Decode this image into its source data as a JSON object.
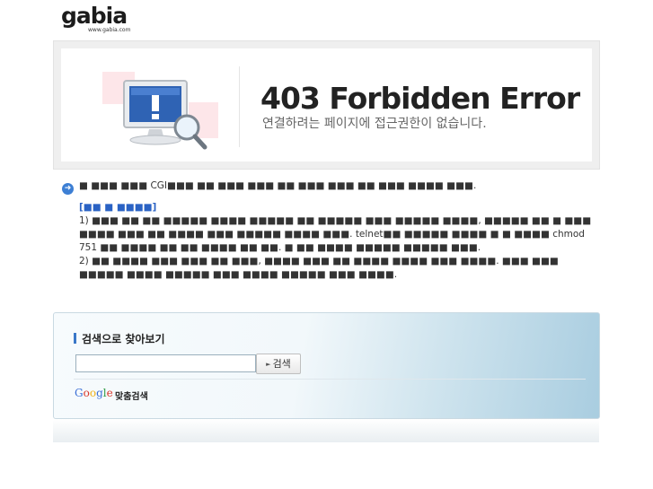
{
  "logo": {
    "word": "gabia",
    "url": "www.gabia.com"
  },
  "error": {
    "title": "403 Forbidden Error",
    "subtitle": "연결하려는 페이지에 접근권한이 없습니다."
  },
  "info": {
    "line1": "■ ■■■ ■■■ CGI■■■ ■■ ■■■ ■■■ ■■ ■■■ ■■■ ■■ ■■■ ■■■■ ■■■.",
    "heading": "[■■ ■ ■■■■]",
    "line2": "1) ■■■ ■■ ■■ ■■■■■ ■■■■ ■■■■■ ■■ ■■■■■ ■■■ ■■■■■ ■■■■, ■■■■■ ■■ ■ ■■■ ■■■■ ■■■ ■■ ■■■■ ■■■ ■■■■■ ■■■■ ■■■. telnet■■ ■■■■■ ■■■■ ■ ■ ■■■■ chmod 751 ■■ ■■■■ ■■ ■■ ■■■■ ■■ ■■. ■ ■■ ■■■■ ■■■■■ ■■■■■ ■■■.",
    "line3": "2) ■■ ■■■■ ■■■ ■■■ ■■ ■■■, ■■■■ ■■■ ■■ ■■■■ ■■■■ ■■■ ■■■■. ■■■ ■■■ ■■■■■ ■■■■ ■■■■■ ■■■ ■■■■ ■■■■■ ■■■ ■■■■."
  },
  "search": {
    "title": "검색으로 찾아보기",
    "input_value": "",
    "button_label": "검색",
    "google_label": "맞춤검색",
    "google_letters": [
      "G",
      "o",
      "o",
      "g",
      "l",
      "e"
    ]
  },
  "colors": {
    "accent": "#3a78c8",
    "pink": "#fde6e9",
    "logo_dot": "#e23a2e"
  }
}
